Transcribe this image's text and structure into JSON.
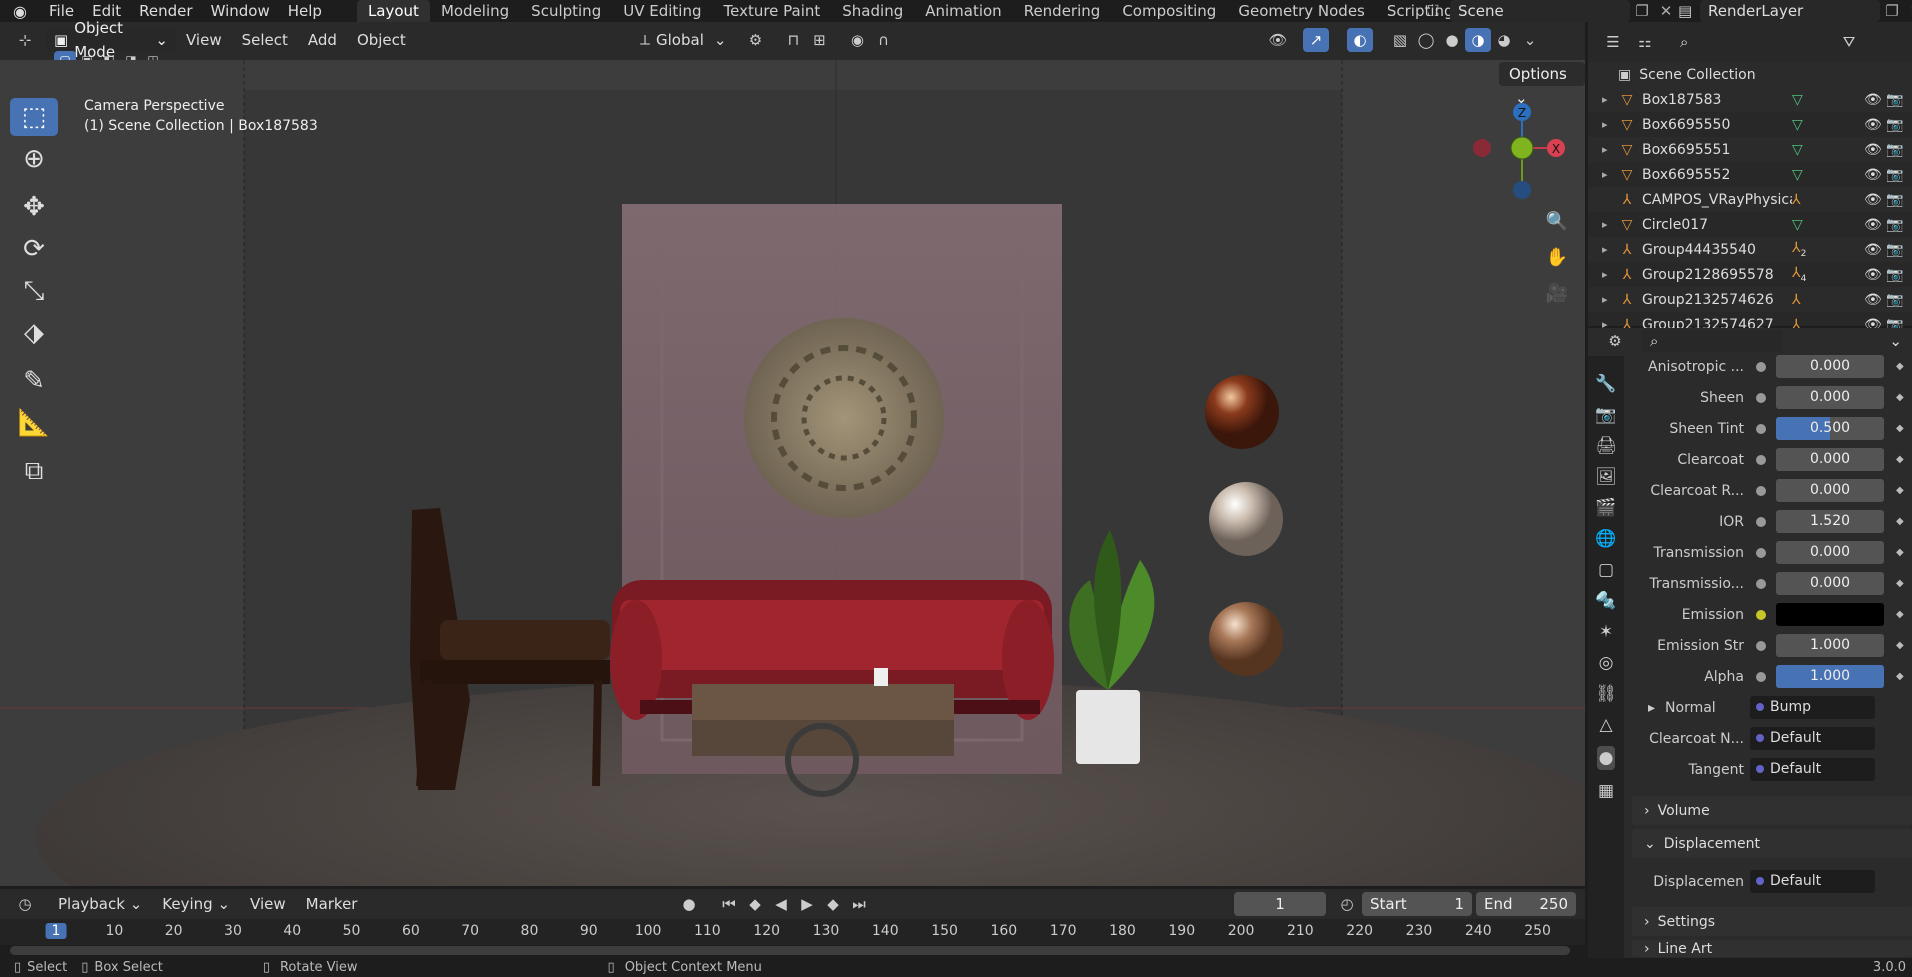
{
  "topbar": {
    "menus": [
      "File",
      "Edit",
      "Render",
      "Window",
      "Help"
    ],
    "workspaces": [
      "Layout",
      "Modeling",
      "Sculpting",
      "UV Editing",
      "Texture Paint",
      "Shading",
      "Animation",
      "Rendering",
      "Compositing",
      "Geometry Nodes",
      "Scripting"
    ],
    "active_workspace": "Layout",
    "add_tab": "+",
    "scene": "Scene",
    "view_layer": "RenderLayer"
  },
  "viewport_header": {
    "mode": "Object Mode",
    "menus": [
      "View",
      "Select",
      "Add",
      "Object"
    ],
    "transform_orientation": "Global",
    "options": "Options"
  },
  "viewport": {
    "camera_label": "Camera Perspective",
    "collection_label": "(1) Scene Collection | Box187583",
    "gizmo": {
      "z": "Z",
      "x": "X"
    }
  },
  "outliner": {
    "root": "Scene Collection",
    "items": [
      {
        "name": "Box187583",
        "icon": "mesh-icon"
      },
      {
        "name": "Box6695550",
        "icon": "mesh-icon"
      },
      {
        "name": "Box6695551",
        "icon": "mesh-icon"
      },
      {
        "name": "Box6695552",
        "icon": "mesh-icon"
      },
      {
        "name": "CAMPOS_VRayPhysicalCa",
        "icon": "empty-icon"
      },
      {
        "name": "Circle017",
        "icon": "mesh-icon"
      },
      {
        "name": "Group44435540",
        "icon": "empty-icon",
        "badge": "2"
      },
      {
        "name": "Group2128695578",
        "icon": "empty-icon",
        "badge": "4"
      },
      {
        "name": "Group2132574626",
        "icon": "empty-icon"
      },
      {
        "name": "Group2132574627",
        "icon": "empty-icon"
      }
    ]
  },
  "properties": {
    "rows": [
      {
        "label": "Anisotropic ...",
        "value": "0.000"
      },
      {
        "label": "Sheen",
        "value": "0.000"
      },
      {
        "label": "Sheen Tint",
        "value": "0.500",
        "fill": 0.5
      },
      {
        "label": "Clearcoat",
        "value": "0.000"
      },
      {
        "label": "Clearcoat R...",
        "value": "0.000"
      },
      {
        "label": "IOR",
        "value": "1.520"
      },
      {
        "label": "Transmission",
        "value": "0.000"
      },
      {
        "label": "Transmissio...",
        "value": "0.000"
      },
      {
        "label": "Emission",
        "value": "",
        "color": "#000000"
      },
      {
        "label": "Emission Str",
        "value": "1.000"
      },
      {
        "label": "Alpha",
        "value": "1.000",
        "fill": 1.0
      }
    ],
    "normal": {
      "label": "Normal",
      "value": "Bump"
    },
    "clearcoat_normal": {
      "label": "Clearcoat N...",
      "value": "Default"
    },
    "tangent": {
      "label": "Tangent",
      "value": "Default"
    },
    "panels": {
      "volume": "Volume",
      "displacement": "Displacement",
      "settings": "Settings",
      "line_art": "Line Art"
    },
    "displacement": {
      "label": "Displacemen",
      "value": "Default"
    }
  },
  "timeline": {
    "menus": [
      "Playback",
      "Keying",
      "View",
      "Marker"
    ],
    "current_frame": "1",
    "start_label": "Start",
    "start": "1",
    "end_label": "End",
    "end": "250",
    "ticks": [
      "1",
      "10",
      "20",
      "30",
      "40",
      "50",
      "60",
      "70",
      "80",
      "90",
      "100",
      "110",
      "120",
      "130",
      "140",
      "150",
      "160",
      "170",
      "180",
      "190",
      "200",
      "210",
      "220",
      "230",
      "240",
      "250"
    ]
  },
  "statusbar": {
    "select": "Select",
    "box_select": "Box Select",
    "rotate": "Rotate View",
    "context": "Object Context Menu",
    "version": "3.0.0"
  },
  "colors": {
    "accent": "#4772b3",
    "header": "#2a2a2a",
    "viewport": "#3d3d3d"
  }
}
